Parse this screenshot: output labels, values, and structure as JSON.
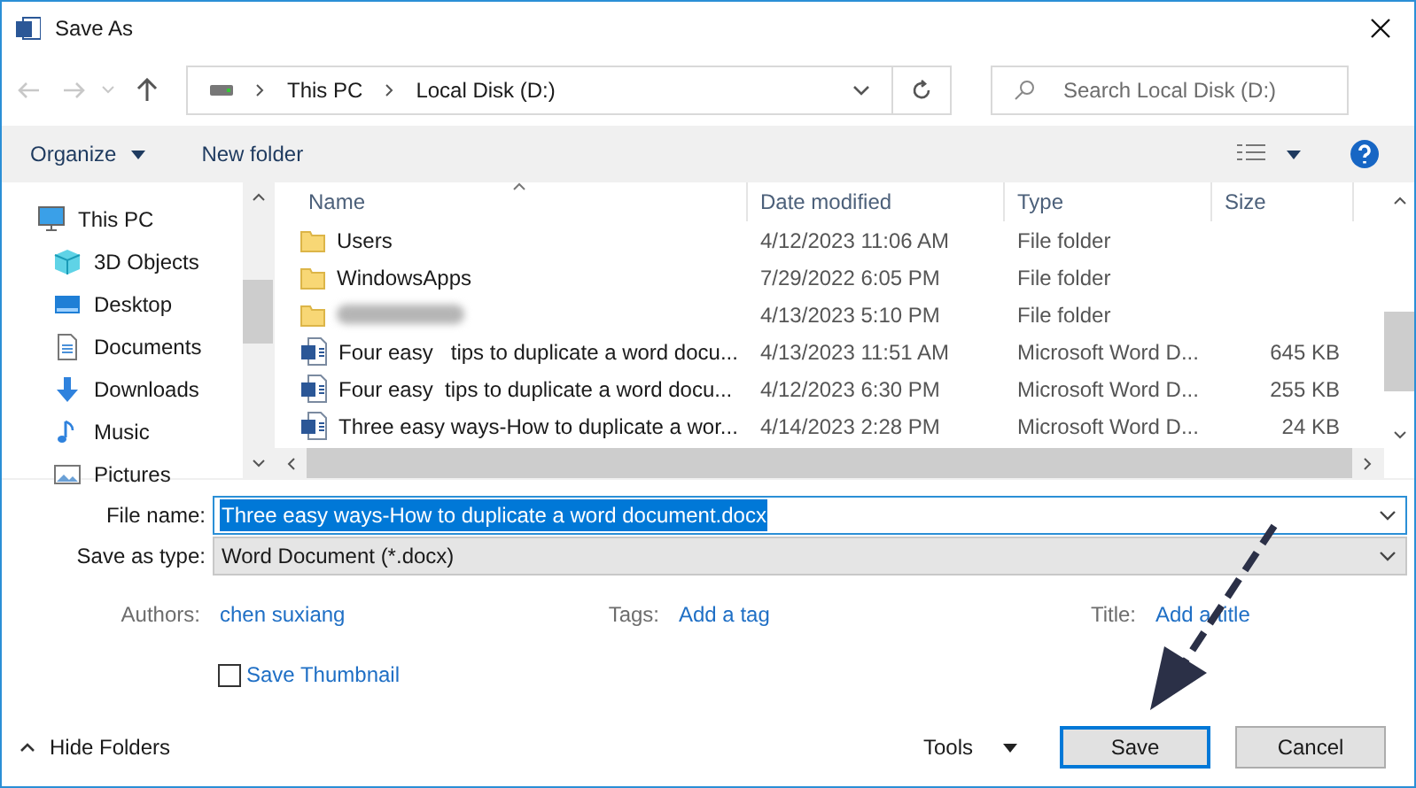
{
  "window": {
    "title": "Save As"
  },
  "address": {
    "crumbs": [
      "This PC",
      "Local Disk (D:)"
    ]
  },
  "search": {
    "placeholder": "Search Local Disk (D:)"
  },
  "toolbar": {
    "organize": "Organize",
    "new_folder": "New folder"
  },
  "sidebar": {
    "items": [
      {
        "label": "This PC",
        "kind": "pc",
        "children": [
          {
            "label": "3D Objects",
            "kind": "cube"
          },
          {
            "label": "Desktop",
            "kind": "desktop"
          },
          {
            "label": "Documents",
            "kind": "documents"
          },
          {
            "label": "Downloads",
            "kind": "downloads"
          },
          {
            "label": "Music",
            "kind": "music"
          },
          {
            "label": "Pictures",
            "kind": "pictures"
          }
        ]
      }
    ]
  },
  "table": {
    "columns": [
      "Name",
      "Date modified",
      "Type",
      "Size"
    ],
    "rows": [
      {
        "kind": "folder",
        "name": "Users",
        "date": "4/12/2023 11:06 AM",
        "type": "File folder"
      },
      {
        "kind": "folder",
        "name": "WindowsApps",
        "date": "7/29/2022 6:05 PM",
        "type": "File folder"
      },
      {
        "kind": "folder",
        "blurred": true,
        "date": "4/13/2023 5:10 PM",
        "type": "File folder"
      },
      {
        "kind": "word",
        "name": "Four easy   tips to duplicate a word docu...",
        "date": "4/13/2023 11:51 AM",
        "type": "Microsoft Word D...",
        "size": "645 KB"
      },
      {
        "kind": "word",
        "name": "Four easy  tips to duplicate a word docu...",
        "date": "4/12/2023 6:30 PM",
        "type": "Microsoft Word D...",
        "size": "255 KB"
      },
      {
        "kind": "word",
        "name": "Three easy ways-How to duplicate a wor...",
        "date": "4/14/2023 2:28 PM",
        "type": "Microsoft Word D...",
        "size": "24 KB"
      }
    ]
  },
  "form": {
    "file_name_label": "File name:",
    "file_name": "Three easy ways-How to duplicate a word document.docx",
    "type_label": "Save as type:",
    "type": "Word Document (*.docx)",
    "meta": [
      {
        "label": "Authors:",
        "value": "chen suxiang"
      },
      {
        "label": "Tags:",
        "value": "Add a tag"
      },
      {
        "label": "Title:",
        "value": "Add a title"
      }
    ],
    "thumbnail": {
      "label": "Save Thumbnail",
      "checked": false
    }
  },
  "footer": {
    "hide_folders": "Hide Folders",
    "tools": "Tools",
    "save": "Save",
    "cancel": "Cancel"
  }
}
